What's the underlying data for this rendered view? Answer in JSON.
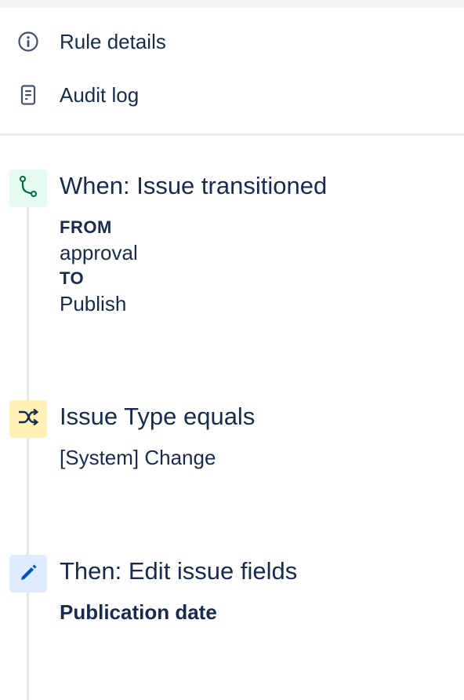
{
  "nav": {
    "rule_details_label": "Rule details",
    "audit_log_label": "Audit log"
  },
  "components": {
    "trigger": {
      "title": "When: Issue transitioned",
      "from_keyword": "FROM",
      "from_value": "approval",
      "to_keyword": "TO",
      "to_value": "Publish",
      "icon": "transition-icon",
      "color": "#006644",
      "bg": "#e3fcef"
    },
    "condition": {
      "title": "Issue Type equals",
      "value": "[System] Change",
      "icon": "shuffle-icon",
      "color": "#172b4d",
      "bg": "#fff0b3"
    },
    "action": {
      "title": "Then: Edit issue fields",
      "value": "Publication date",
      "icon": "pencil-icon",
      "color": "#0052cc",
      "bg": "#deebff"
    }
  }
}
